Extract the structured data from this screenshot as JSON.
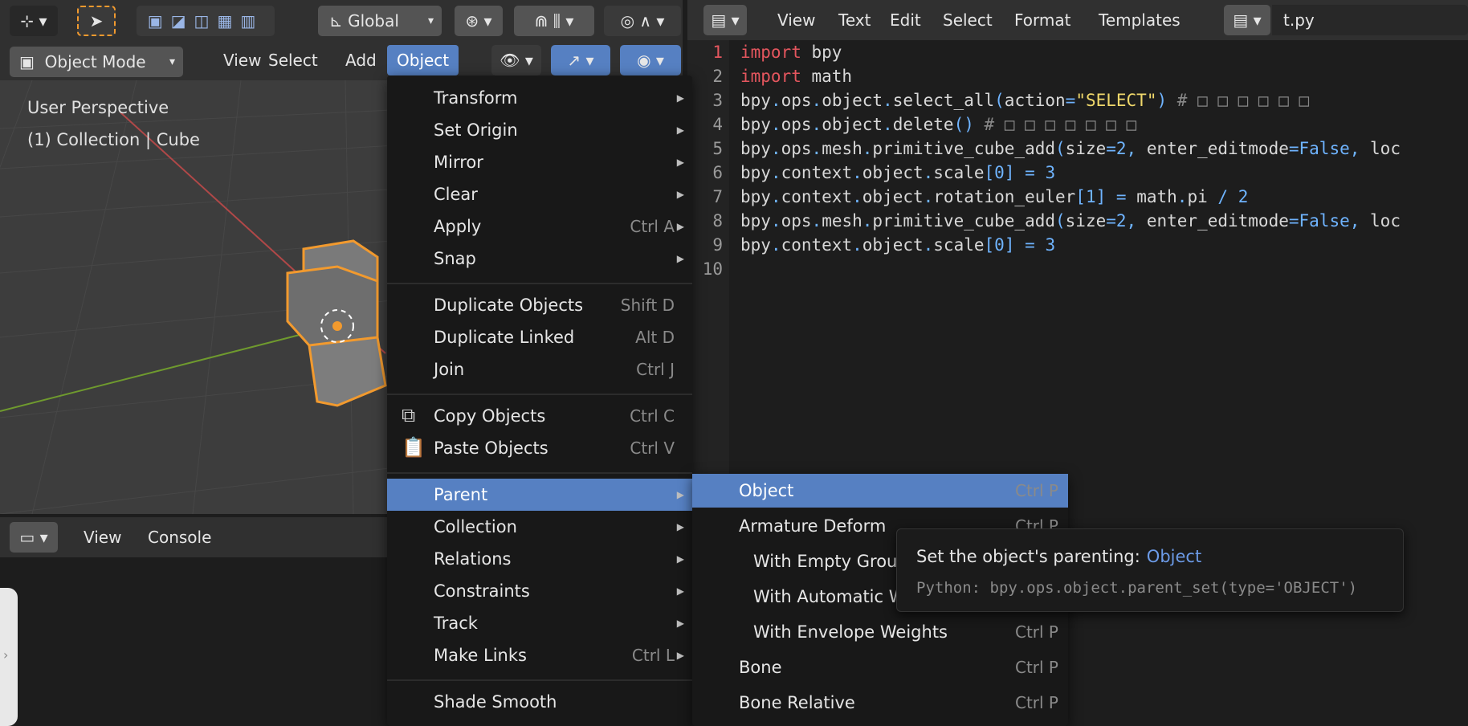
{
  "viewport": {
    "header": {
      "orientation_label": "Global",
      "mode_label": "Object Mode",
      "menus": [
        "View",
        "Select",
        "Add",
        "Object"
      ]
    },
    "overlay": {
      "perspective": "User Perspective",
      "collection": "(1) Collection | Cube"
    }
  },
  "console": {
    "menus": [
      "View",
      "Console"
    ]
  },
  "text_editor": {
    "menus": [
      "View",
      "Text",
      "Edit",
      "Select",
      "Format",
      "Templates"
    ],
    "filename": "t.py",
    "line_numbers": [
      "1",
      "2",
      "3",
      "4",
      "5",
      "6",
      "7",
      "8",
      "9",
      "10"
    ],
    "lines": [
      "import bpy",
      "import math",
      "bpy.ops.object.select_all(action=\"SELECT\") # □ □ □ □ □ □",
      "bpy.ops.object.delete() # □ □ □ □ □ □ □",
      "bpy.ops.mesh.primitive_cube_add(size=2, enter_editmode=False, loc",
      "bpy.context.object.scale[0] = 3",
      "bpy.context.object.rotation_euler[1] = math.pi / 2",
      "bpy.ops.mesh.primitive_cube_add(size=2, enter_editmode=False, loc",
      "bpy.context.object.scale[0] = 3",
      ""
    ]
  },
  "object_menu": {
    "items": [
      {
        "label": "Transform",
        "shortcut": "",
        "submenu": true
      },
      {
        "label": "Set Origin",
        "shortcut": "",
        "submenu": true
      },
      {
        "label": "Mirror",
        "shortcut": "",
        "submenu": true
      },
      {
        "label": "Clear",
        "shortcut": "",
        "submenu": true
      },
      {
        "label": "Apply",
        "shortcut": "Ctrl A",
        "submenu": true
      },
      {
        "label": "Snap",
        "shortcut": "",
        "submenu": true
      },
      {
        "label": "Duplicate Objects",
        "shortcut": "Shift D",
        "submenu": false
      },
      {
        "label": "Duplicate Linked",
        "shortcut": "Alt D",
        "submenu": false
      },
      {
        "label": "Join",
        "shortcut": "Ctrl J",
        "submenu": false
      },
      {
        "label": "Copy Objects",
        "shortcut": "Ctrl C",
        "submenu": false
      },
      {
        "label": "Paste Objects",
        "shortcut": "Ctrl V",
        "submenu": false
      },
      {
        "label": "Parent",
        "shortcut": "",
        "submenu": true
      },
      {
        "label": "Collection",
        "shortcut": "",
        "submenu": true
      },
      {
        "label": "Relations",
        "shortcut": "",
        "submenu": true
      },
      {
        "label": "Constraints",
        "shortcut": "",
        "submenu": true
      },
      {
        "label": "Track",
        "shortcut": "",
        "submenu": true
      },
      {
        "label": "Make Links",
        "shortcut": "Ctrl L",
        "submenu": true
      },
      {
        "label": "Shade Smooth",
        "shortcut": "",
        "submenu": false
      }
    ]
  },
  "parent_menu": {
    "items": [
      {
        "label": "Object",
        "shortcut": "Ctrl P"
      },
      {
        "label": "Armature Deform",
        "shortcut": "Ctrl P"
      },
      {
        "label": "With Empty Groups",
        "shortcut": ""
      },
      {
        "label": "With Automatic Weights",
        "shortcut": ""
      },
      {
        "label": "With Envelope Weights",
        "shortcut": "Ctrl P"
      },
      {
        "label": "Bone",
        "shortcut": "Ctrl P"
      },
      {
        "label": "Bone Relative",
        "shortcut": "Ctrl P"
      }
    ]
  },
  "tooltip": {
    "title": "Set the object's parenting:",
    "value": "Object",
    "python": "Python: bpy.ops.object.parent_set(type='OBJECT')"
  },
  "colors": {
    "accent": "#5680c2",
    "selection_orange": "#f29a2e"
  }
}
